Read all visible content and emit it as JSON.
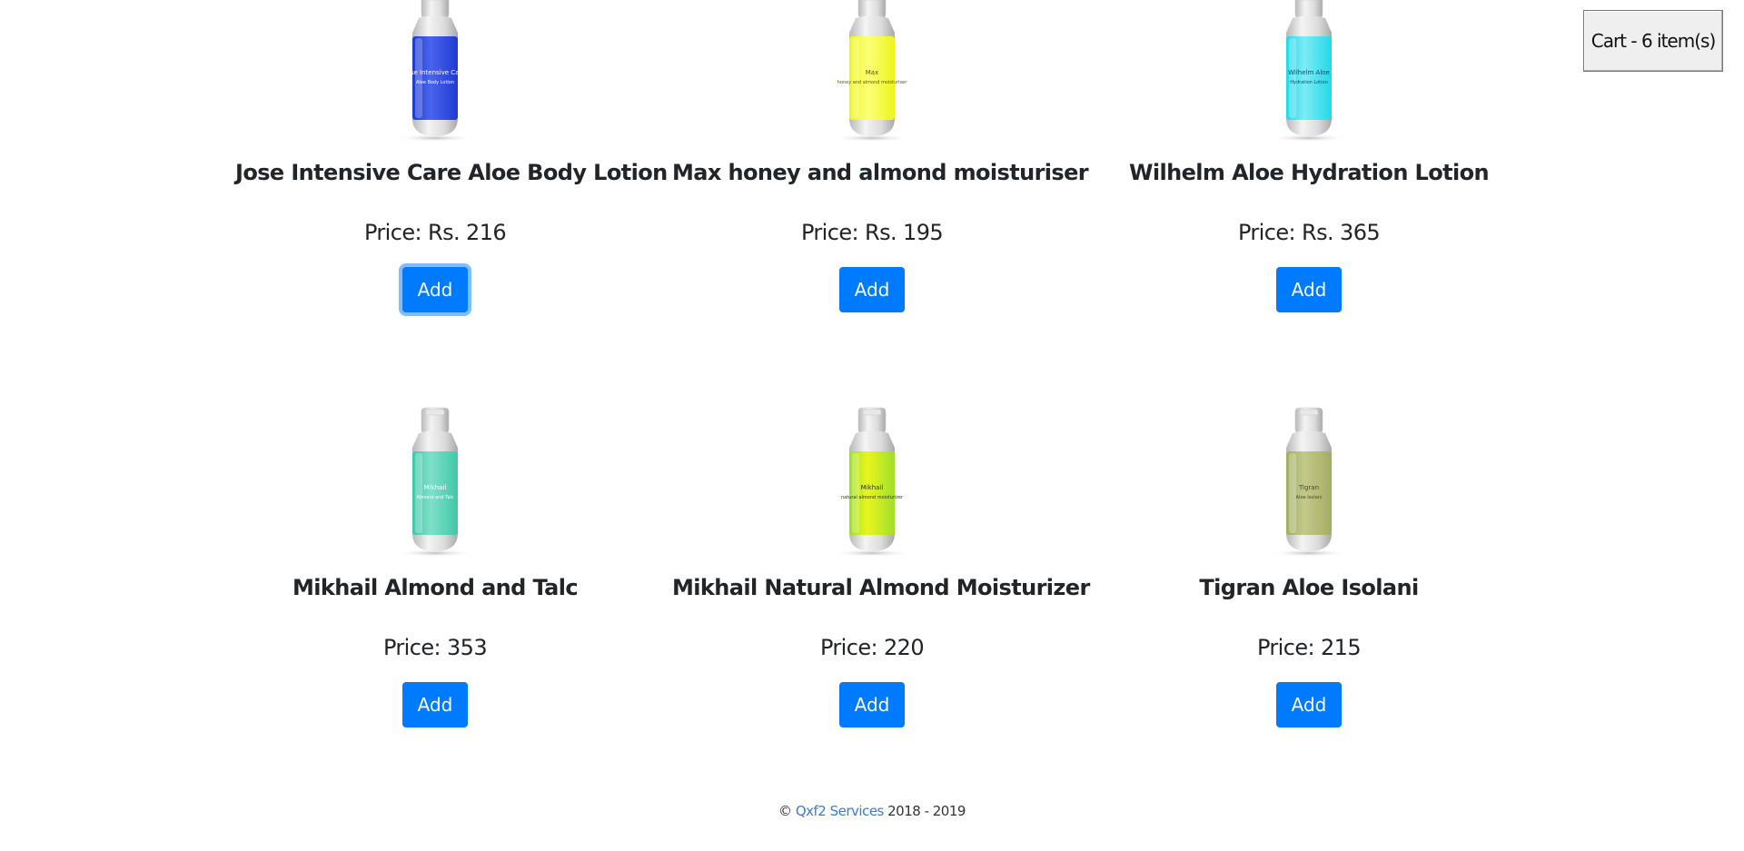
{
  "cart": {
    "label": "Cart - 6 item(s)"
  },
  "products": [
    {
      "name": "Jose Intensive Care Aloe Body Lotion",
      "price": "Price: Rs. 216",
      "button": "Add",
      "bottle_color": "#1f3bd0",
      "bottle_highlight": "#4a64ef",
      "label_lines": [
        "Jose Intensive Care",
        "Aloe Body Lotion"
      ],
      "label_color": "#ffffff"
    },
    {
      "name": "Max honey and almond moisturiser",
      "price": "Price: Rs. 195",
      "button": "Add",
      "bottle_color": "#eef51a",
      "bottle_highlight": "#fbff7a",
      "label_lines": [
        "Max",
        "honey and almond moisturiser"
      ],
      "label_color": "#5a5a00"
    },
    {
      "name": "Wilhelm Aloe Hydration Lotion",
      "price": "Price: Rs. 365",
      "button": "Add",
      "bottle_color": "#22d8e8",
      "bottle_highlight": "#7cecf5",
      "label_lines": [
        "Wilhelm Aloe",
        "Hydration Lotion"
      ],
      "label_color": "#0b4d6b"
    },
    {
      "name": "Mikhail Almond and Talc",
      "price": "Price: 353",
      "button": "Add",
      "bottle_color": "#3fc8a8",
      "bottle_highlight": "#7fe0c8",
      "label_lines": [
        "Mikhail",
        "Almond and Talc"
      ],
      "label_color": "#ffffff"
    },
    {
      "name": "Mikhail Natural Almond Moisturizer",
      "price": "Price: 220",
      "button": "Add",
      "bottle_color": "#9ee02a",
      "bottle_highlight": "#e9f51e",
      "label_lines": [
        "Mikhail",
        "natural almond moisturizer"
      ],
      "label_color": "#2a3a10"
    },
    {
      "name": "Tigran Aloe Isolani",
      "price": "Price: 215",
      "button": "Add",
      "bottle_color": "#a4ad62",
      "bottle_highlight": "#c3c98a",
      "label_lines": [
        "Tigran",
        "Aloe Isolani"
      ],
      "label_color": "#4a4a2a"
    }
  ],
  "footer": {
    "prefix": "© ",
    "link": "Qxf2 Services",
    "suffix": " 2018 - 2019"
  },
  "colors": {
    "primary": "#007bff",
    "link": "#3a7bd5"
  }
}
